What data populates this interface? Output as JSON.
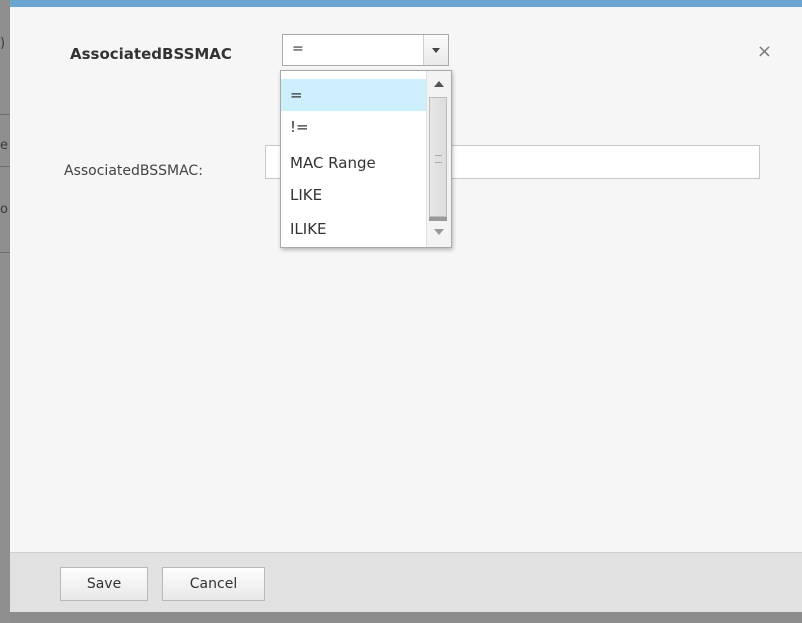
{
  "background": {
    "edge_chars": [
      ")",
      "e",
      "o"
    ]
  },
  "dialog": {
    "header_label": "AssociatedBSSMAC",
    "operator_select": {
      "selected": "=",
      "options": [
        "=",
        "!=",
        "MAC Range",
        "LIKE",
        "ILIKE"
      ]
    },
    "field_label": "AssociatedBSSMAC:",
    "field_value": "",
    "close_glyph": "×",
    "footer": {
      "save_label": "Save",
      "cancel_label": "Cancel"
    }
  },
  "colors": {
    "accent_top_border": "#6aa6cf",
    "selected_option_bg": "#cdeefb",
    "dialog_bg": "#f6f6f6",
    "footer_bg": "#e1e1e1"
  }
}
